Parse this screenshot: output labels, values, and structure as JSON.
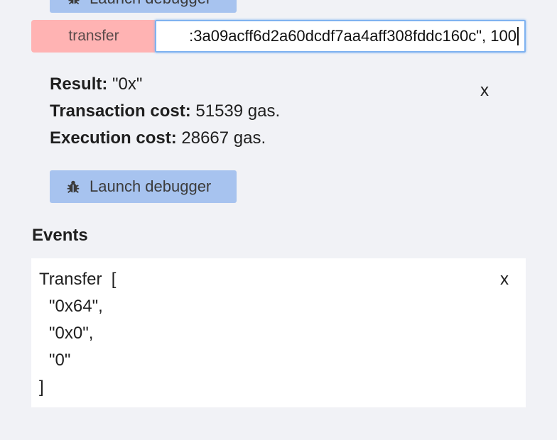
{
  "top_debugger": {
    "label": "Launch debugger",
    "icon": "bug-icon"
  },
  "function_call": {
    "button_label": "transfer",
    "input_value": ":3a09acff6d2a60dcdf7aa4aff308fddc160c\", 100"
  },
  "result": {
    "result_label": "Result:",
    "result_value": "\"0x\"",
    "tx_cost_label": "Transaction cost:",
    "tx_cost_value": "51539 gas.",
    "exec_cost_label": "Execution cost:",
    "exec_cost_value": "28667 gas.",
    "close_label": "x"
  },
  "debugger": {
    "label": "Launch debugger",
    "icon": "bug-icon"
  },
  "events": {
    "title": "Events",
    "close_label": "x",
    "event_name_line": "Transfer  [",
    "args": [
      "\"0x64\",",
      "\"0x0\",",
      "\"0\""
    ],
    "closing": "]"
  },
  "colors": {
    "background": "#f1f2f6",
    "function_button": "#ffb3b3",
    "debug_button": "#a7c3ef",
    "input_focus_border": "#7fb2f0",
    "panel": "#ffffff"
  }
}
